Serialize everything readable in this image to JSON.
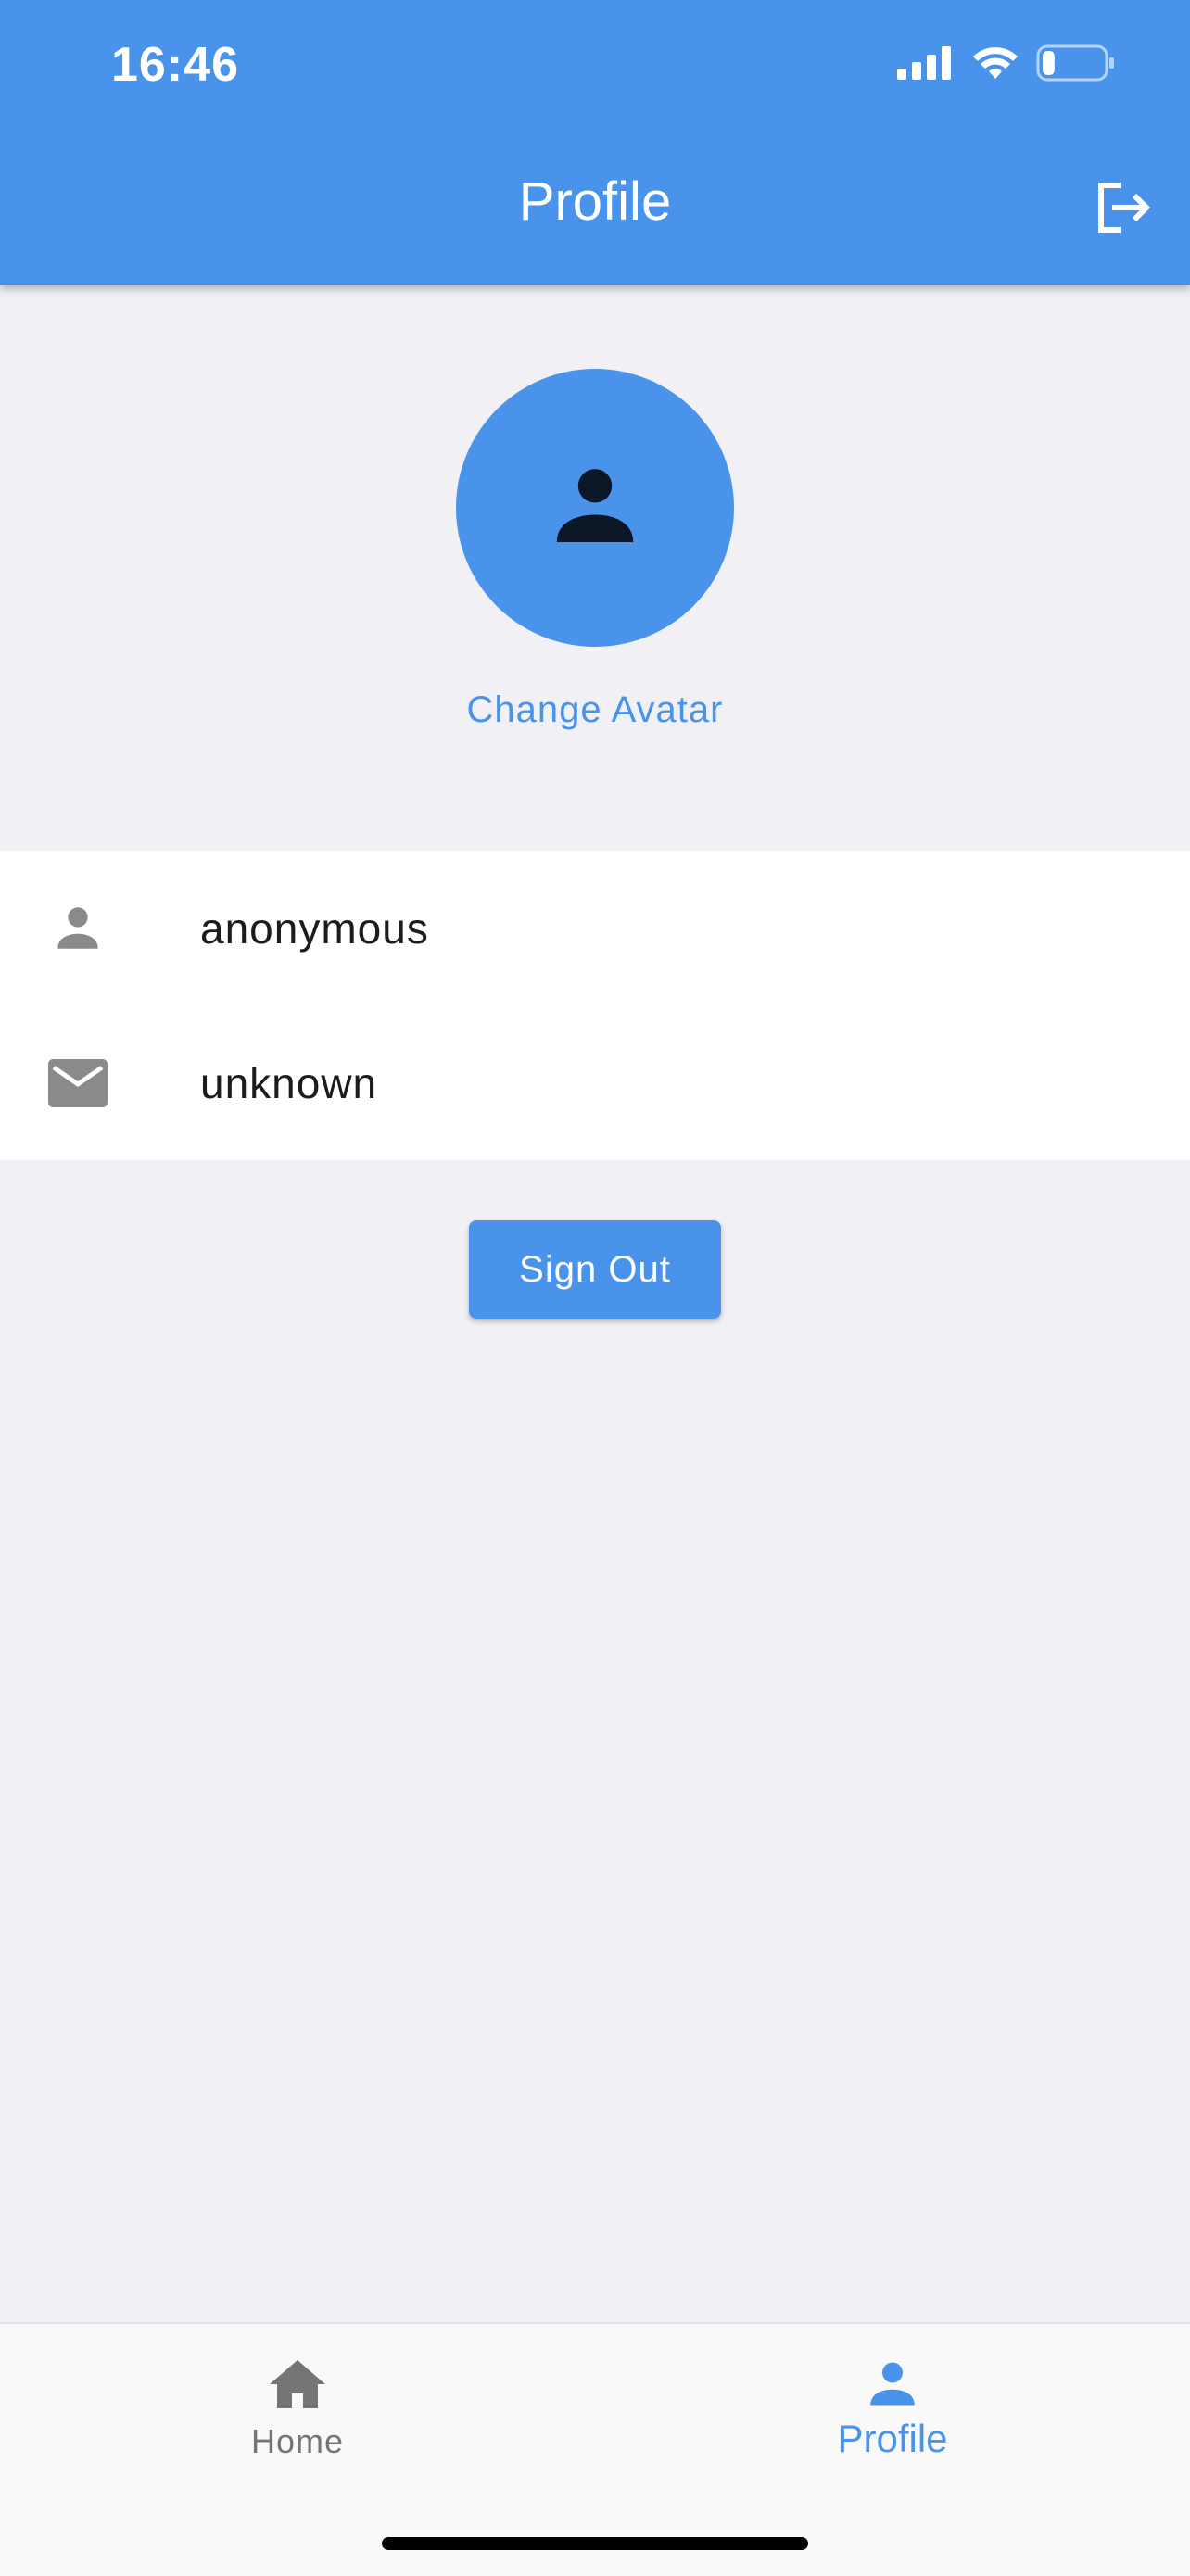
{
  "status_bar": {
    "time": "16:46",
    "icons": [
      "cellular-signal-icon",
      "wifi-icon",
      "battery-icon"
    ],
    "battery_level": 0.2
  },
  "app_bar": {
    "title": "Profile",
    "action_icon": "logout-icon"
  },
  "profile": {
    "avatar_icon": "person-icon",
    "change_avatar_label": "Change Avatar",
    "fields": [
      {
        "icon": "person-icon",
        "value": "anonymous"
      },
      {
        "icon": "mail-icon",
        "value": "unknown"
      }
    ],
    "sign_out_label": "Sign Out"
  },
  "bottom_nav": {
    "items": [
      {
        "icon": "home-icon",
        "label": "Home",
        "active": false
      },
      {
        "icon": "person-icon",
        "label": "Profile",
        "active": true
      }
    ]
  },
  "colors": {
    "primary": "#4a93eb",
    "background": "#f0f0f5",
    "inactive": "#757575",
    "avatar_glyph": "#0b1626"
  }
}
